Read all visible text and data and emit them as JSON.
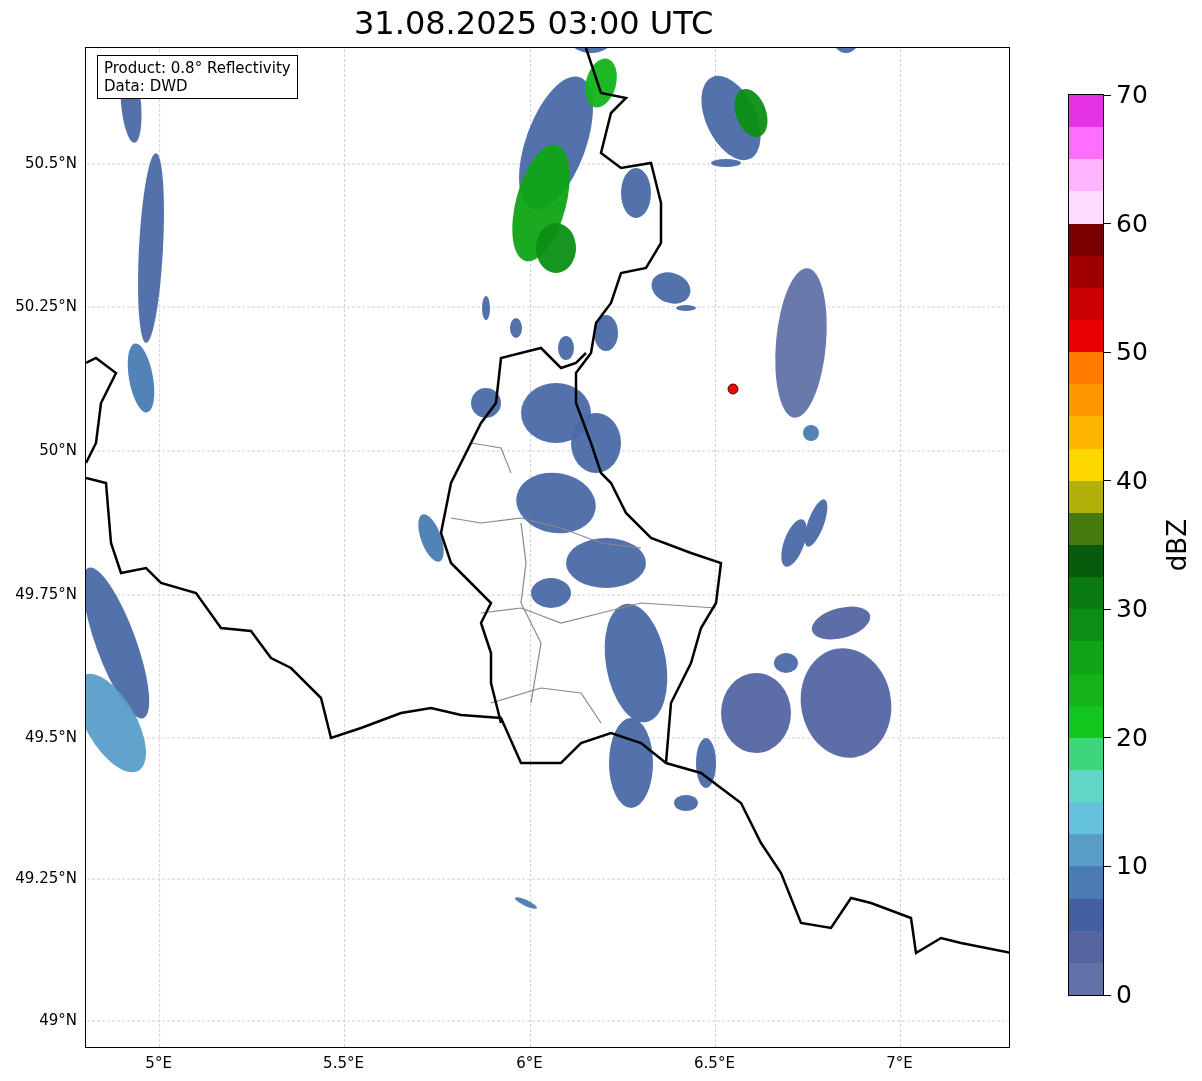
{
  "title": "31.08.2025 03:00 UTC",
  "info_box": [
    "Product: 0.8° Reflectivity",
    "Data: DWD"
  ],
  "x_ticks": [
    "5°E",
    "5.5°E",
    "6°E",
    "6.5°E",
    "7°E"
  ],
  "y_ticks": [
    "50.5°N",
    "50.25°N",
    "50°N",
    "49.75°N",
    "49.5°N",
    "49.25°N",
    "49°N"
  ],
  "colorbar": {
    "label": "dBZ",
    "ticks": [
      "70",
      "60",
      "50",
      "40",
      "30",
      "20",
      "10",
      "0"
    ],
    "segments": [
      {
        "color": "#e632e6"
      },
      {
        "color": "#ff6eff"
      },
      {
        "color": "#ffb4ff"
      },
      {
        "color": "#ffdcff"
      },
      {
        "color": "#7a0000"
      },
      {
        "color": "#a00000"
      },
      {
        "color": "#c80000"
      },
      {
        "color": "#e60000"
      },
      {
        "color": "#ff7c00"
      },
      {
        "color": "#ff9800"
      },
      {
        "color": "#ffb400"
      },
      {
        "color": "#ffd700"
      },
      {
        "color": "#b0b008"
      },
      {
        "color": "#467a0c"
      },
      {
        "color": "#085a0c"
      },
      {
        "color": "#0a7a12"
      },
      {
        "color": "#0c8e14"
      },
      {
        "color": "#10a416"
      },
      {
        "color": "#12b41a"
      },
      {
        "color": "#12c61e"
      },
      {
        "color": "#3dd67a"
      },
      {
        "color": "#5fd8c8"
      },
      {
        "color": "#65c2dc"
      },
      {
        "color": "#5a9ec8"
      },
      {
        "color": "#4a7bb3"
      },
      {
        "color": "#4360a4"
      },
      {
        "color": "#5465a2"
      },
      {
        "color": "#6272a8"
      }
    ]
  }
}
